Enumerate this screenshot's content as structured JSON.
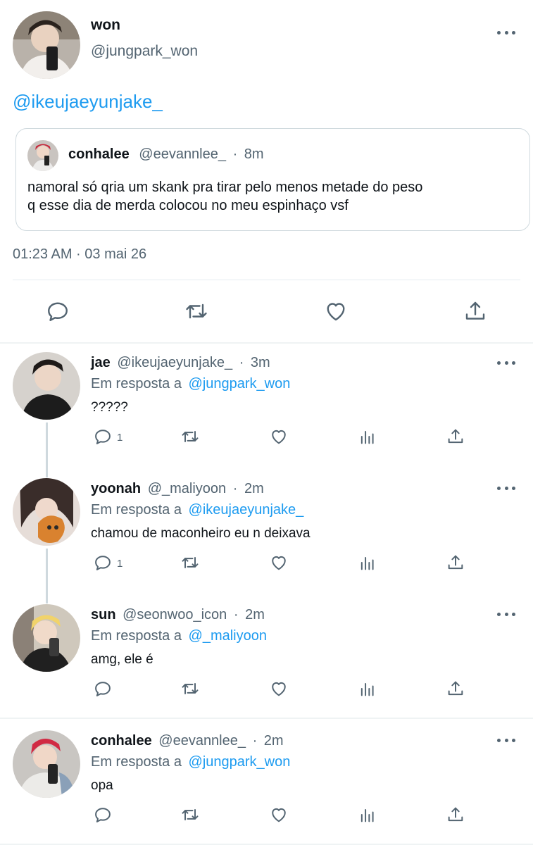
{
  "main_tweet": {
    "author_name": "won",
    "author_handle": "@jungpark_won",
    "text": "@ikeujaeyunjake_",
    "quoted": {
      "author_name": "conhalee",
      "author_handle": "@eevannlee_",
      "separator": "·",
      "time": "8m",
      "text_line1": "namoral só qria um skank pra tirar pelo menos metade do peso",
      "text_line2": "q esse dia de merda colocou no meu espinhaço vsf"
    },
    "timestamp": "01:23 AM · 03 mai 26"
  },
  "replies": [
    {
      "author_name": "jae",
      "author_handle": "@ikeujaeyunjake_",
      "separator": "·",
      "time": "3m",
      "replying_prefix": "Em resposta a",
      "replying_to": "@jungpark_won",
      "text": "?????",
      "reply_count": "1"
    },
    {
      "author_name": "yoonah",
      "author_handle": "@_maliyoon",
      "separator": "·",
      "time": "2m",
      "replying_prefix": "Em resposta a",
      "replying_to": "@ikeujaeyunjake_",
      "text": "chamou de maconheiro eu n deixava",
      "reply_count": "1"
    },
    {
      "author_name": "sun",
      "author_handle": "@seonwoo_icon",
      "separator": "·",
      "time": "2m",
      "replying_prefix": "Em resposta a",
      "replying_to": "@_maliyoon",
      "text": "amg, ele é",
      "reply_count": ""
    },
    {
      "author_name": "conhalee",
      "author_handle": "@eevannlee_",
      "separator": "·",
      "time": "2m",
      "replying_prefix": "Em resposta a",
      "replying_to": "@jungpark_won",
      "text": "opa",
      "reply_count": ""
    }
  ],
  "icons": {
    "reply": "reply-icon",
    "retweet": "retweet-icon",
    "like": "like-icon",
    "views": "views-icon",
    "share": "share-icon",
    "more": "more-icon"
  },
  "colors": {
    "link": "#1d9bf0",
    "text": "#0f1419",
    "muted": "#536471",
    "divider": "#eff3f4"
  }
}
